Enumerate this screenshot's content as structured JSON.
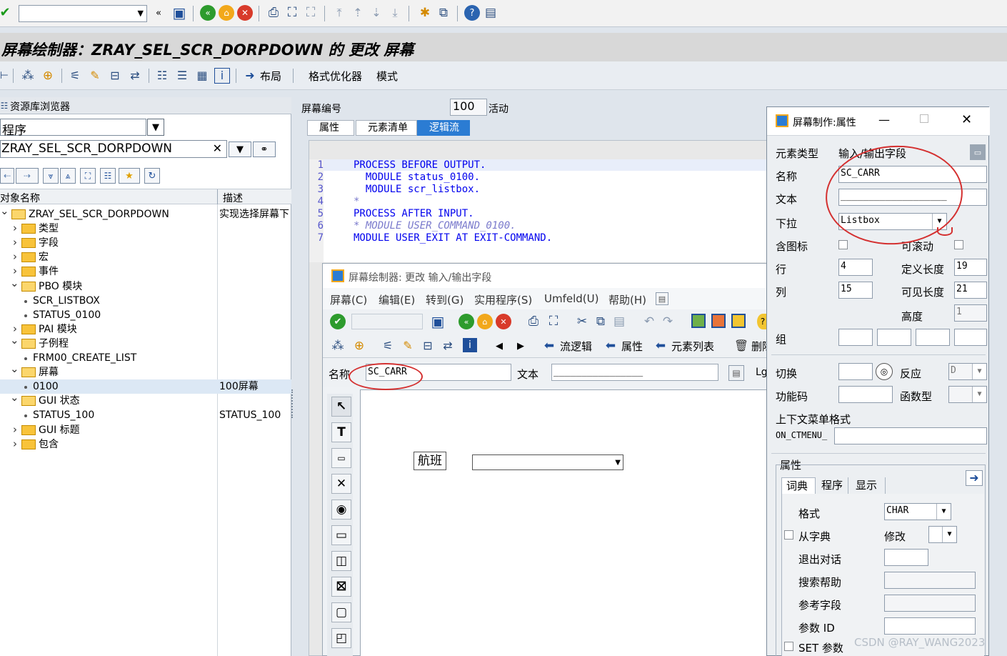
{
  "top_toolbar": {
    "command_field_value": "",
    "icons": [
      "enter-icon",
      "back-icon",
      "save-icon",
      "back-green-icon",
      "exit-icon",
      "cancel-icon",
      "print-icon",
      "find-icon",
      "find-next-icon",
      "first-page-icon",
      "prev-page-icon",
      "next-page-icon",
      "last-page-icon",
      "new-session-icon",
      "shortcut-icon",
      "help-icon",
      "customize-layout-icon"
    ]
  },
  "window_title": "屏幕绘制器：ZRAY_SEL_SCR_DORPDOWN 的 更改 屏幕",
  "app_toolbar": {
    "layout_button": "布局",
    "format_optimizer": "格式优化器",
    "mode": "模式"
  },
  "repository_browser": {
    "title": "资源库浏览器",
    "object_type": "程序",
    "object_name": "ZRAY_SEL_SCR_DORPDOWN",
    "col_object_name": "对象名称",
    "col_description": "描述",
    "tree": [
      {
        "label": "ZRAY_SEL_SCR_DORPDOWN",
        "desc": "实现选择屏幕下"
      },
      {
        "label": "类型",
        "desc": ""
      },
      {
        "label": "字段",
        "desc": ""
      },
      {
        "label": "宏",
        "desc": ""
      },
      {
        "label": "事件",
        "desc": ""
      },
      {
        "label": "PBO 模块",
        "desc": ""
      },
      {
        "label": "SCR_LISTBOX",
        "desc": ""
      },
      {
        "label": "STATUS_0100",
        "desc": ""
      },
      {
        "label": "PAI 模块",
        "desc": ""
      },
      {
        "label": "子例程",
        "desc": ""
      },
      {
        "label": "FRM00_CREATE_LIST",
        "desc": ""
      },
      {
        "label": "屏幕",
        "desc": ""
      },
      {
        "label": "0100",
        "desc": "100屏幕"
      },
      {
        "label": "GUI 状态",
        "desc": ""
      },
      {
        "label": "STATUS_100",
        "desc": "STATUS_100"
      },
      {
        "label": "GUI 标题",
        "desc": ""
      },
      {
        "label": "包含",
        "desc": ""
      }
    ]
  },
  "screen_header": {
    "screen_number_label": "屏幕编号",
    "screen_number": "100",
    "status": "活动",
    "tabs": [
      "属性",
      "元素清单",
      "逻辑流"
    ],
    "active_tab": "逻辑流"
  },
  "flow_logic": {
    "line_numbers": [
      "1",
      "2",
      "3",
      "4",
      "5",
      "6",
      "7"
    ],
    "lines": [
      "PROCESS BEFORE OUTPUT.",
      "  MODULE status_0100.",
      "  MODULE scr_listbox.",
      "*",
      "PROCESS AFTER INPUT.",
      "* MODULE USER_COMMAND_0100.",
      "MODULE USER_EXIT AT EXIT-COMMAND."
    ]
  },
  "painter": {
    "title": "屏幕绘制器:  更改 输入/输出字段",
    "menu": [
      "屏幕(C)",
      "编辑(E)",
      "转到(G)",
      "实用程序(S)",
      "Umfeld(U)",
      "帮助(H)"
    ],
    "toolbar2": {
      "flow_logic": "流逻辑",
      "attributes": "属性",
      "element_list": "元素列表",
      "delete": "删除"
    },
    "name_label": "名称",
    "name_value": "SC_CARR",
    "text_label": "文本",
    "text_value": "________________",
    "lg_label": "Lg",
    "canvas_label": "航班"
  },
  "properties": {
    "title": "屏幕制作:属性",
    "element_type_label": "元素类型",
    "element_type": "输入/输出字段",
    "name_label": "名称",
    "name": "SC_CARR",
    "text_label": "文本",
    "text": "___________________",
    "dropdown_label": "下拉",
    "dropdown": "Listbox",
    "with_icon_label": "含图标",
    "scrollable_label": "可滚动",
    "row_label": "行",
    "row": "4",
    "col_label": "列",
    "col": "15",
    "def_length_label": "定义长度",
    "def_length": "19",
    "vis_length_label": "可见长度",
    "vis_length": "21",
    "height_label": "高度",
    "height": "1",
    "group_label": "组",
    "toggle_label": "切换",
    "response_label": "反应",
    "response": "D",
    "fcode_label": "功能码",
    "ftype_label": "函数型",
    "context_menu_label": "上下文菜单格式",
    "on_ctmenu": "ON_CTMENU_",
    "attributes_group": "属性",
    "sub_tabs": [
      "词典",
      "程序",
      "显示"
    ],
    "format_label": "格式",
    "format": "CHAR",
    "from_dict_label": "从字典",
    "modify_label": "修改",
    "exit_dialog_label": "退出对话",
    "search_help_label": "搜索帮助",
    "ref_field_label": "参考字段",
    "param_id_label": "参数 ID",
    "set_param_label": "SET 参数"
  },
  "watermark": "CSDN @RAY_WANG2023",
  "colors": {
    "active_tab": "#2b7cd3",
    "annotation": "#d43030",
    "code_keyword": "#0000ee"
  }
}
